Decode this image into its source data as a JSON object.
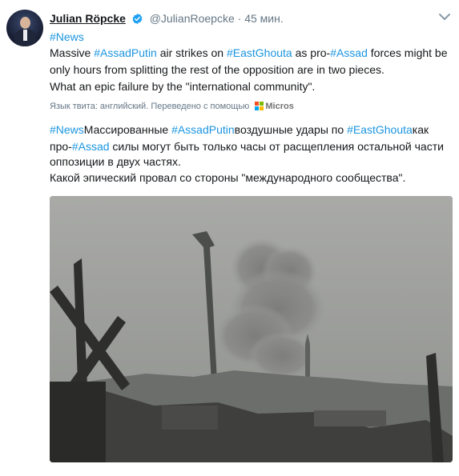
{
  "author": {
    "name": "Julian Röpcke",
    "handle": "@JulianRoepcke",
    "separator": "·",
    "time": "45 мин."
  },
  "icons": {
    "verified": "verified-badge-icon",
    "menu": "chevron-down-icon",
    "translator_logo": "microsoft-logo-icon"
  },
  "colors": {
    "link": "#1b95e0",
    "text": "#14171a",
    "muted": "#657786"
  },
  "tweet_original": {
    "line1": {
      "hashtag": "#News"
    },
    "line2": {
      "t1": "Massive ",
      "h1": "#AssadPutin",
      "t2": " air strikes on ",
      "h2": "#EastGhouta",
      "t3": " as pro-",
      "h3": "#Assad",
      "t4": " forces might be"
    },
    "line3": "only hours from splitting the rest of the opposition are in two pieces.",
    "line4": "What an epic failure by the \"international community\"."
  },
  "translation_bar": {
    "label": "Язык твита: английский. Переведено с помощью",
    "provider_text": "Micros"
  },
  "tweet_translated": {
    "line1": {
      "h1": "#News",
      "t1": "Массированные ",
      "h2": "#AssadPutin",
      "t2": "воздушные удары по ",
      "h3": "#EastGhouta",
      "t3": "как"
    },
    "line2": {
      "t1": "про-",
      "h1": "#Assad",
      "t2": " силы могут быть только часы от расщепления остальной части"
    },
    "line3": "оппозиции в двух частях.",
    "line4": "Какой эпический провал со стороны \"международного сообщества\"."
  }
}
